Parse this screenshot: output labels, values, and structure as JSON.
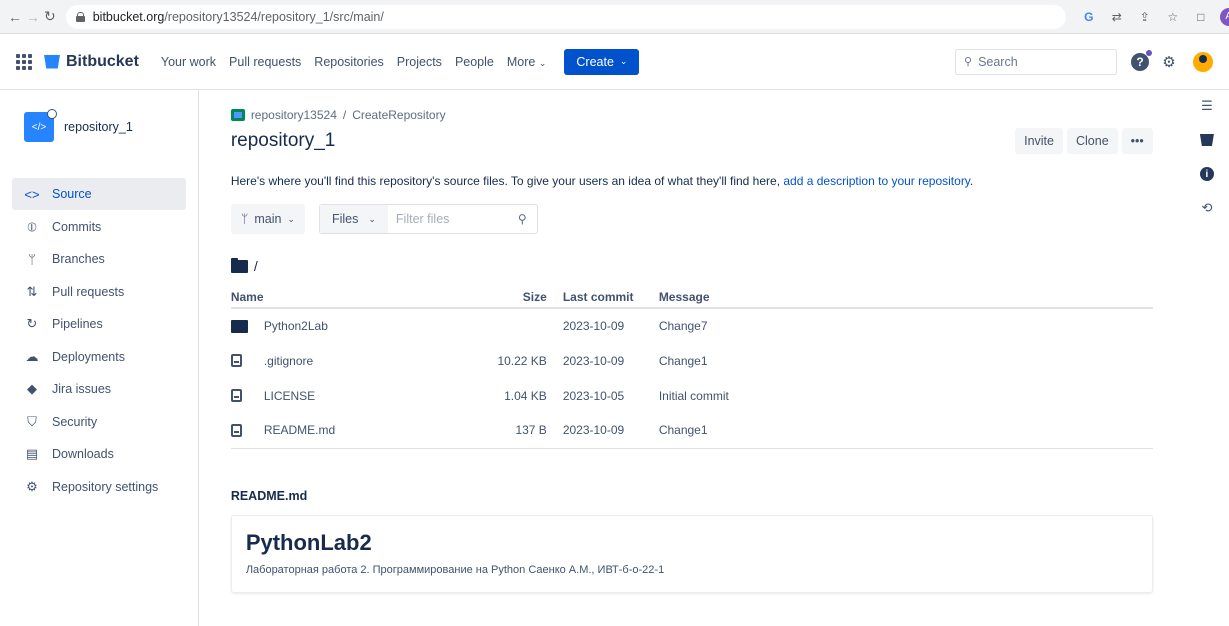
{
  "browser": {
    "url_host": "bitbucket.org",
    "url_path": "/repository13524/repository_1/src/main/",
    "profile_initial": "A"
  },
  "topnav": {
    "brand": "Bitbucket",
    "items": [
      "Your work",
      "Pull requests",
      "Repositories",
      "Projects",
      "People"
    ],
    "more_label": "More",
    "create_label": "Create",
    "search_placeholder": "Search"
  },
  "sidebar": {
    "repo_name": "repository_1",
    "items": [
      {
        "label": "Source",
        "icon": "source-icon",
        "active": true
      },
      {
        "label": "Commits",
        "icon": "commit-icon"
      },
      {
        "label": "Branches",
        "icon": "branch-icon"
      },
      {
        "label": "Pull requests",
        "icon": "pull-request-icon"
      },
      {
        "label": "Pipelines",
        "icon": "pipelines-icon"
      },
      {
        "label": "Deployments",
        "icon": "deployments-icon"
      },
      {
        "label": "Jira issues",
        "icon": "jira-icon"
      },
      {
        "label": "Security",
        "icon": "shield-icon"
      },
      {
        "label": "Downloads",
        "icon": "download-icon"
      },
      {
        "label": "Repository settings",
        "icon": "gear-icon"
      }
    ]
  },
  "main": {
    "breadcrumb_workspace": "repository13524",
    "breadcrumb_project": "CreateRepository",
    "title": "repository_1",
    "invite_label": "Invite",
    "clone_label": "Clone",
    "more_label": "•••",
    "description_prefix": "Here's where you'll find this repository's source files. To give your users an idea of what they'll find here,",
    "description_link": "add a description to your repository",
    "description_suffix": ".",
    "branch": "main",
    "files_label": "Files",
    "filter_placeholder": "Filter files",
    "path": "/",
    "table_headers": {
      "name": "Name",
      "size": "Size",
      "last_commit": "Last commit",
      "message": "Message"
    },
    "files": [
      {
        "name": "Python2Lab",
        "type": "folder",
        "size": "",
        "last_commit": "2023-10-09",
        "message": "Change7"
      },
      {
        "name": ".gitignore",
        "type": "file",
        "size": "10.22 KB",
        "last_commit": "2023-10-09",
        "message": "Change1"
      },
      {
        "name": "LICENSE",
        "type": "file",
        "size": "1.04 KB",
        "last_commit": "2023-10-05",
        "message": "Initial commit"
      },
      {
        "name": "README.md",
        "type": "file",
        "size": "137 B",
        "last_commit": "2023-10-09",
        "message": "Change1"
      }
    ],
    "readme_label": "README.md",
    "readme_heading": "PythonLab2",
    "readme_text": "Лабораторная работа 2. Программирование на Python Саенко А.М., ИВТ-б-о-22-1"
  }
}
